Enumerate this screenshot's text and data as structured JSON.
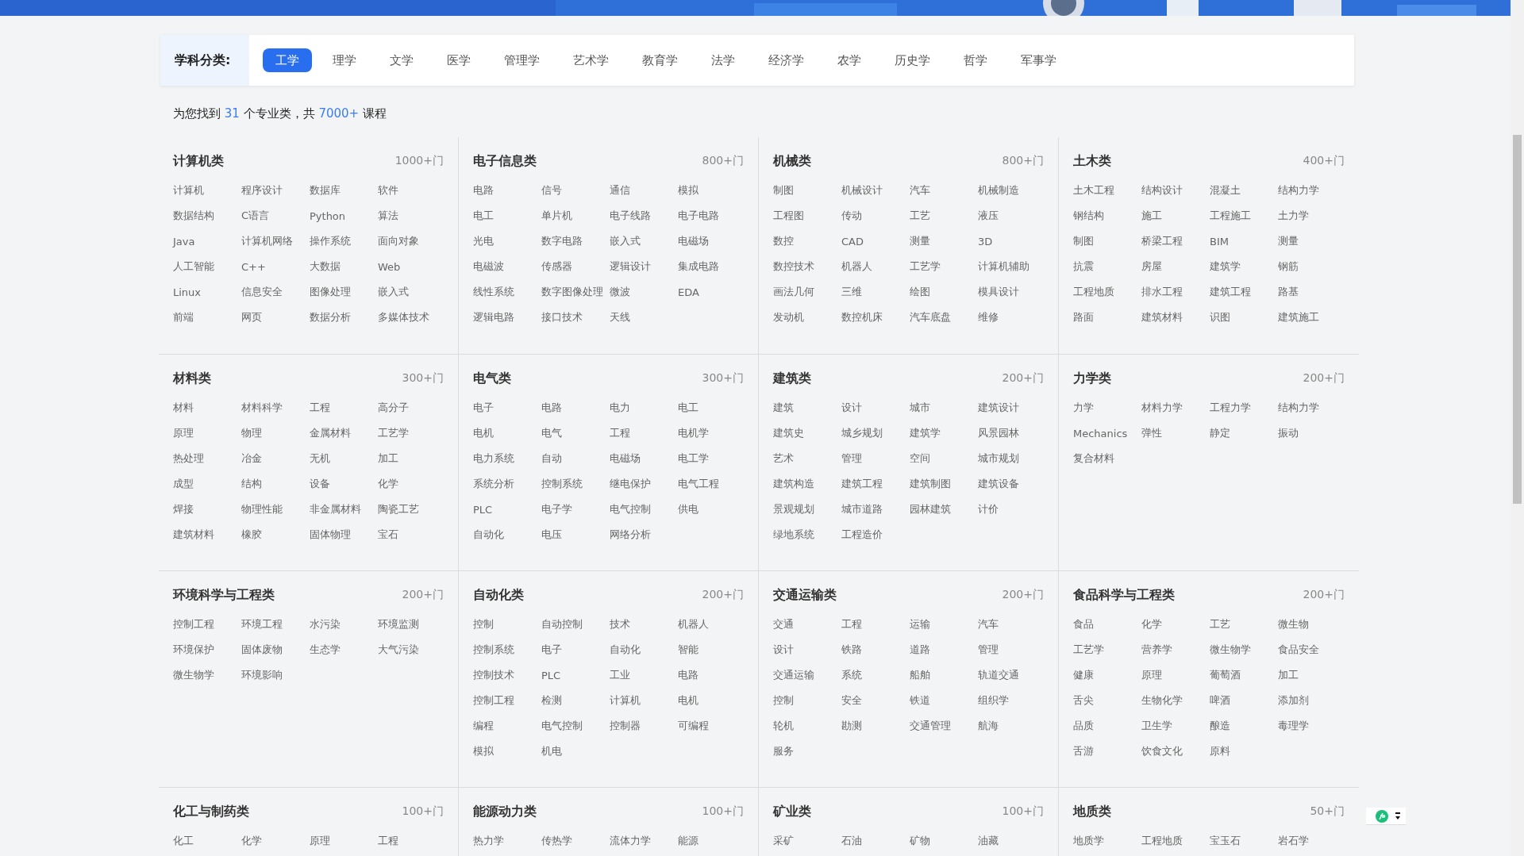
{
  "filter": {
    "label": "学科分类:",
    "tabs": [
      {
        "label": "工学",
        "selected": true
      },
      {
        "label": "理学",
        "selected": false
      },
      {
        "label": "文学",
        "selected": false
      },
      {
        "label": "医学",
        "selected": false
      },
      {
        "label": "管理学",
        "selected": false
      },
      {
        "label": "艺术学",
        "selected": false
      },
      {
        "label": "教育学",
        "selected": false
      },
      {
        "label": "法学",
        "selected": false
      },
      {
        "label": "经济学",
        "selected": false
      },
      {
        "label": "农学",
        "selected": false
      },
      {
        "label": "历史学",
        "selected": false
      },
      {
        "label": "哲学",
        "selected": false
      },
      {
        "label": "军事学",
        "selected": false
      }
    ]
  },
  "summary": {
    "prefix": "为您找到",
    "majors": "31",
    "middle": "个专业类，共",
    "courses": "7000+",
    "suffix": "课程"
  },
  "categories": [
    {
      "name": "计算机类",
      "count": "1000+门",
      "items": [
        "计算机",
        "程序设计",
        "数据库",
        "软件",
        "数据结构",
        "C语言",
        "Python",
        "算法",
        "Java",
        "计算机网络",
        "操作系统",
        "面向对象",
        "人工智能",
        "C++",
        "大数据",
        "Web",
        "Linux",
        "信息安全",
        "图像处理",
        "嵌入式",
        "前端",
        "网页",
        "数据分析",
        "多媒体技术"
      ]
    },
    {
      "name": "电子信息类",
      "count": "800+门",
      "items": [
        "电路",
        "信号",
        "通信",
        "模拟",
        "电工",
        "单片机",
        "电子线路",
        "电子电路",
        "光电",
        "数字电路",
        "嵌入式",
        "电磁场",
        "电磁波",
        "传感器",
        "逻辑设计",
        "集成电路",
        "线性系统",
        "数字图像处理",
        "微波",
        "EDA",
        "逻辑电路",
        "接口技术",
        "天线"
      ]
    },
    {
      "name": "机械类",
      "count": "800+门",
      "items": [
        "制图",
        "机械设计",
        "汽车",
        "机械制造",
        "工程图",
        "传动",
        "工艺",
        "液压",
        "数控",
        "CAD",
        "测量",
        "3D",
        "数控技术",
        "机器人",
        "工艺学",
        "计算机辅助",
        "画法几何",
        "三维",
        "绘图",
        "模具设计",
        "发动机",
        "数控机床",
        "汽车底盘",
        "维修"
      ]
    },
    {
      "name": "土木类",
      "count": "400+门",
      "items": [
        "土木工程",
        "结构设计",
        "混凝土",
        "结构力学",
        "钢结构",
        "施工",
        "工程施工",
        "土力学",
        "制图",
        "桥梁工程",
        "BIM",
        "测量",
        "抗震",
        "房屋",
        "建筑学",
        "钢筋",
        "工程地质",
        "排水工程",
        "建筑工程",
        "路基",
        "路面",
        "建筑材料",
        "识图",
        "建筑施工"
      ]
    },
    {
      "name": "材料类",
      "count": "300+门",
      "items": [
        "材料",
        "材料科学",
        "工程",
        "高分子",
        "原理",
        "物理",
        "金属材料",
        "工艺学",
        "热处理",
        "冶金",
        "无机",
        "加工",
        "成型",
        "结构",
        "设备",
        "化学",
        "焊接",
        "物理性能",
        "非金属材料",
        "陶瓷工艺",
        "建筑材料",
        "橡胶",
        "固体物理",
        "宝石"
      ]
    },
    {
      "name": "电气类",
      "count": "300+门",
      "items": [
        "电子",
        "电路",
        "电力",
        "电工",
        "电机",
        "电气",
        "工程",
        "电机学",
        "电力系统",
        "自动",
        "电磁场",
        "电工学",
        "系统分析",
        "控制系统",
        "继电保护",
        "电气工程",
        "PLC",
        "电子学",
        "电气控制",
        "供电",
        "自动化",
        "电压",
        "网络分析"
      ]
    },
    {
      "name": "建筑类",
      "count": "200+门",
      "items": [
        "建筑",
        "设计",
        "城市",
        "建筑设计",
        "建筑史",
        "城乡规划",
        "建筑学",
        "风景园林",
        "艺术",
        "管理",
        "空间",
        "城市规划",
        "建筑构造",
        "建筑工程",
        "建筑制图",
        "建筑设备",
        "景观规划",
        "城市道路",
        "园林建筑",
        "计价",
        "绿地系统",
        "工程造价"
      ]
    },
    {
      "name": "力学类",
      "count": "200+门",
      "items": [
        "力学",
        "材料力学",
        "工程力学",
        "结构力学",
        "Mechanics",
        "弹性",
        "静定",
        "振动",
        "复合材料"
      ]
    },
    {
      "name": "环境科学与工程类",
      "count": "200+门",
      "items": [
        "控制工程",
        "环境工程",
        "水污染",
        "环境监测",
        "环境保护",
        "固体废物",
        "生态学",
        "大气污染",
        "微生物学",
        "环境影响"
      ]
    },
    {
      "name": "自动化类",
      "count": "200+门",
      "items": [
        "控制",
        "自动控制",
        "技术",
        "机器人",
        "控制系统",
        "电子",
        "自动化",
        "智能",
        "控制技术",
        "PLC",
        "工业",
        "电路",
        "控制工程",
        "检测",
        "计算机",
        "电机",
        "编程",
        "电气控制",
        "控制器",
        "可编程",
        "模拟",
        "机电"
      ]
    },
    {
      "name": "交通运输类",
      "count": "200+门",
      "items": [
        "交通",
        "工程",
        "运输",
        "汽车",
        "设计",
        "铁路",
        "道路",
        "管理",
        "交通运输",
        "系统",
        "船舶",
        "轨道交通",
        "控制",
        "安全",
        "铁道",
        "组织学",
        "轮机",
        "勘测",
        "交通管理",
        "航海",
        "服务"
      ]
    },
    {
      "name": "食品科学与工程类",
      "count": "200+门",
      "items": [
        "食品",
        "化学",
        "工艺",
        "微生物",
        "工艺学",
        "营养学",
        "微生物学",
        "食品安全",
        "健康",
        "原理",
        "葡萄酒",
        "加工",
        "舌尖",
        "生物化学",
        "啤酒",
        "添加剂",
        "品质",
        "卫生学",
        "酿造",
        "毒理学",
        "舌游",
        "饮食文化",
        "原料"
      ]
    },
    {
      "name": "化工与制药类",
      "count": "100+门",
      "items": [
        "化工",
        "化学",
        "原理",
        "工程"
      ]
    },
    {
      "name": "能源动力类",
      "count": "100+门",
      "items": [
        "热力学",
        "传热学",
        "流体力学",
        "能源"
      ]
    },
    {
      "name": "矿业类",
      "count": "100+门",
      "items": [
        "采矿",
        "石油",
        "矿物",
        "油藏"
      ]
    },
    {
      "name": "地质类",
      "count": "50+门",
      "items": [
        "地质学",
        "工程地质",
        "宝玉石",
        "岩石学"
      ]
    }
  ]
}
